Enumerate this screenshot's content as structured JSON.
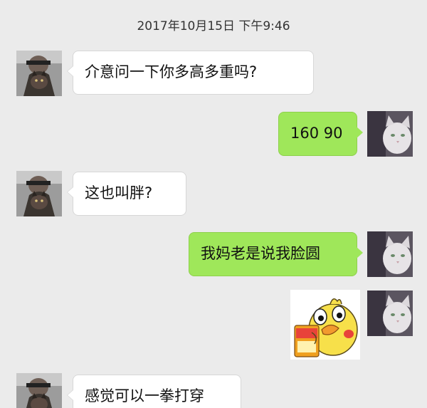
{
  "timestamp": "2017年10月15日 下午9:46",
  "messages": [
    {
      "side": "left",
      "avatar": "user-photo-avatar",
      "text": "介意问一下你多高多重吗?"
    },
    {
      "side": "right",
      "avatar": "cat-photo-avatar",
      "text": "160 90"
    },
    {
      "side": "left",
      "avatar": "user-photo-avatar",
      "text": "这也叫胖?"
    },
    {
      "side": "right",
      "avatar": "cat-photo-avatar",
      "text": "我妈老是说我脸圆"
    },
    {
      "side": "right",
      "avatar": "cat-photo-avatar",
      "sticker": "yellow-chick-sticker"
    },
    {
      "side": "left",
      "avatar": "user-photo-avatar",
      "text": "感觉可以一拳打穿"
    }
  ],
  "colors": {
    "background": "#ebebeb",
    "incoming_bubble": "#ffffff",
    "outgoing_bubble": "#9fe75a"
  }
}
